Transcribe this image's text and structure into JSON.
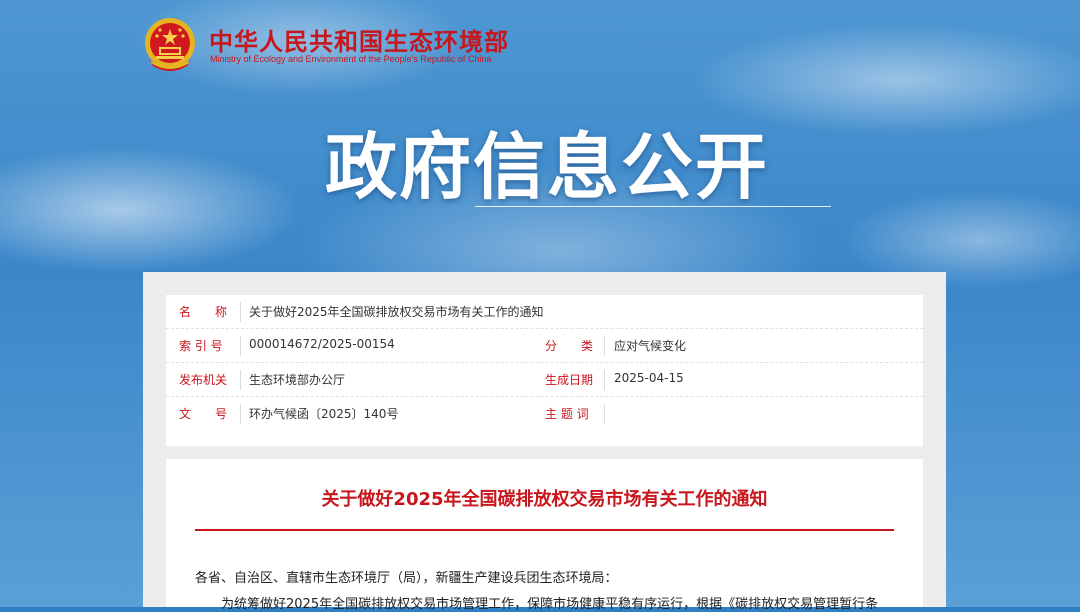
{
  "header": {
    "brand_cn": "中华人民共和国生态环境部",
    "brand_en": "Ministry of Ecology and Environment of the People's Republic of China",
    "emblem_icon": "national-emblem-icon"
  },
  "hero": {
    "title": "政府信息公开"
  },
  "meta": {
    "name_label": "名　　称",
    "name_value": "关于做好2025年全国碳排放权交易市场有关工作的通知",
    "index_label": "索 引 号",
    "index_value": "000014672/2025-00154",
    "category_label": "分　　类",
    "category_value": "应对气候变化",
    "issuer_label": "发布机关",
    "issuer_value": "生态环境部办公厅",
    "date_label": "生成日期",
    "date_value": "2025-04-15",
    "docno_label": "文　　号",
    "docno_value": "环办气候函〔2025〕140号",
    "keywords_label": "主 题 词",
    "keywords_value": ""
  },
  "document": {
    "title": "关于做好2025年全国碳排放权交易市场有关工作的通知",
    "salutation": "各省、自治区、直辖市生态环境厅（局），新疆生产建设兵团生态环境局：",
    "para1": "为统筹做好2025年全国碳排放权交易市场管理工作，保障市场健康平稳有序运行，根据《碳排放权交易管理暂行条"
  },
  "colors": {
    "accent_red": "#c8161d",
    "sky_blue": "#3a86c9",
    "panel_gray": "#ececec"
  }
}
